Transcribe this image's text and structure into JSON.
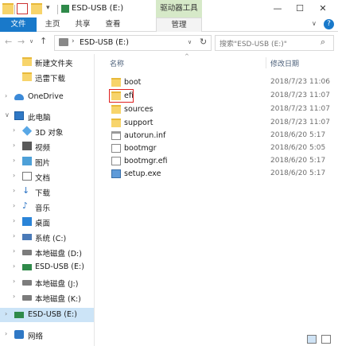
{
  "window": {
    "title": "ESD-USB (E:)",
    "context_tab": "驱动器工具",
    "minimize": "—",
    "maximize": "☐",
    "close": "✕"
  },
  "ribbon": {
    "tabs": [
      {
        "label": "文件"
      },
      {
        "label": "主页"
      },
      {
        "label": "共享"
      },
      {
        "label": "查看"
      },
      {
        "label": "管理"
      }
    ],
    "expand_icon": "chevron-down-icon",
    "help_icon": "help-icon"
  },
  "address": {
    "back": "←",
    "forward": "→",
    "recent": "∨",
    "up": "↑",
    "path": "ESD-USB (E:)",
    "chevron": "›",
    "dropdown": "∨",
    "refresh": "↻"
  },
  "search": {
    "placeholder": "搜索\"ESD-USB (E:)\"",
    "icon": "⌕"
  },
  "nav_pane": {
    "items": [
      {
        "label": "新建文件夹",
        "icon": "folder-icon"
      },
      {
        "label": "迅雷下载",
        "icon": "folder-icon"
      },
      {
        "label": "OneDrive",
        "icon": "onedrive-icon"
      },
      {
        "label": "此电脑",
        "icon": "computer-icon"
      },
      {
        "label": "3D 对象",
        "icon": "3d-objects-icon"
      },
      {
        "label": "视频",
        "icon": "videos-icon"
      },
      {
        "label": "图片",
        "icon": "pictures-icon"
      },
      {
        "label": "文档",
        "icon": "documents-icon"
      },
      {
        "label": "下载",
        "icon": "downloads-icon"
      },
      {
        "label": "音乐",
        "icon": "music-icon"
      },
      {
        "label": "桌面",
        "icon": "desktop-icon"
      },
      {
        "label": "系统 (C:)",
        "icon": "system-drive-icon"
      },
      {
        "label": "本地磁盘 (D:)",
        "icon": "drive-icon"
      },
      {
        "label": "ESD-USB (E:)",
        "icon": "usb-drive-icon"
      },
      {
        "label": "本地磁盘 (J:)",
        "icon": "drive-icon"
      },
      {
        "label": "本地磁盘 (K:)",
        "icon": "drive-icon"
      },
      {
        "label": "ESD-USB (E:)",
        "icon": "usb-drive-icon"
      },
      {
        "label": "网络",
        "icon": "network-icon"
      }
    ],
    "selected": "ESD-USB (E:)"
  },
  "file_list": {
    "columns": {
      "name": "名称",
      "date": "修改日期"
    },
    "sort_arrow": "^",
    "rows": [
      {
        "name": "boot",
        "date": "2018/7/23 11:06",
        "icon": "folder-icon"
      },
      {
        "name": "efi",
        "date": "2018/7/23 11:07",
        "icon": "folder-icon",
        "highlighted": true
      },
      {
        "name": "sources",
        "date": "2018/7/23 11:07",
        "icon": "folder-icon"
      },
      {
        "name": "support",
        "date": "2018/7/23 11:07",
        "icon": "folder-icon"
      },
      {
        "name": "autorun.inf",
        "date": "2018/6/20 5:17",
        "icon": "inf-file-icon"
      },
      {
        "name": "bootmgr",
        "date": "2018/6/20 5:05",
        "icon": "file-icon"
      },
      {
        "name": "bootmgr.efi",
        "date": "2018/6/20 5:17",
        "icon": "file-icon"
      },
      {
        "name": "setup.exe",
        "date": "2018/6/20 5:17",
        "icon": "exe-icon"
      }
    ]
  },
  "colors": {
    "file_tab": "#1979ca",
    "context_tab": "#d6e9c8",
    "selection": "#cce4f7",
    "folder": "#f7d46b",
    "highlight_box": "#e02020"
  }
}
